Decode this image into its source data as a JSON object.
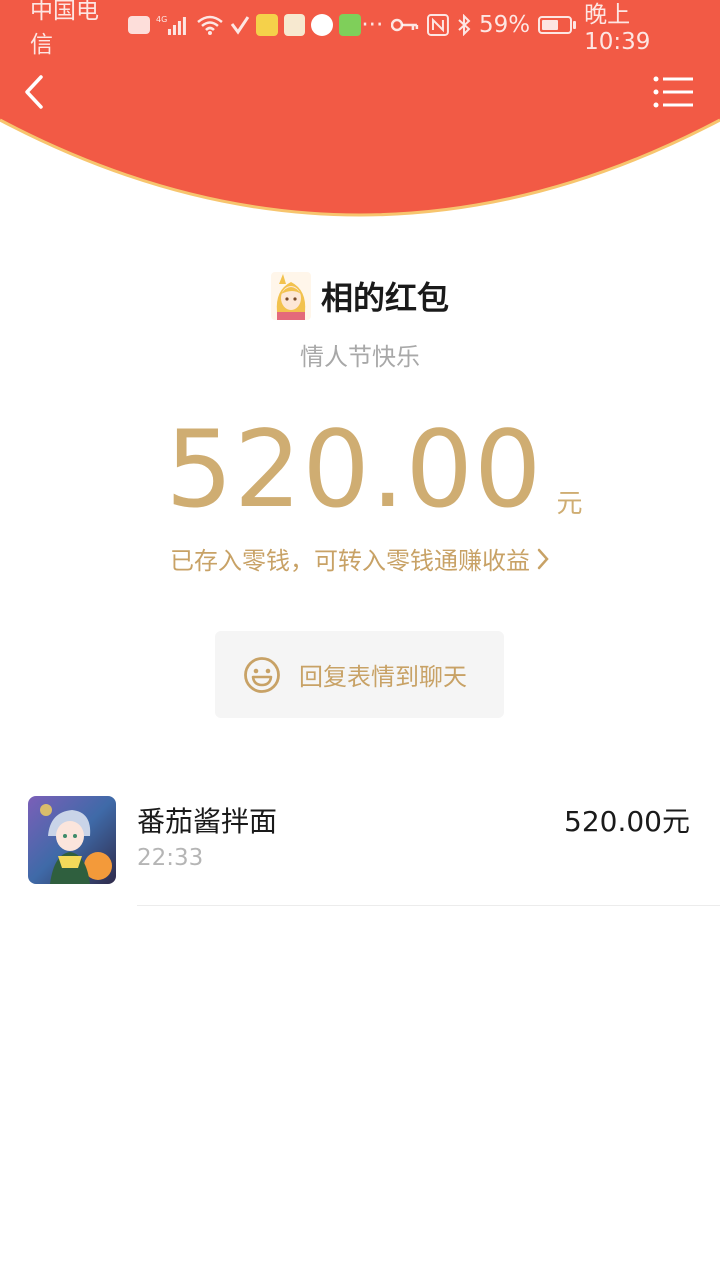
{
  "status_bar": {
    "carrier": "中国电信",
    "battery": "59%",
    "time": "晚上10:39"
  },
  "header": {
    "back_icon": "chevron-left-icon",
    "menu_icon": "list-icon",
    "accent_color": "#f25a45"
  },
  "packet": {
    "sender_name": "相的红包",
    "greeting": "情人节快乐",
    "amount": "520.00",
    "unit": "元",
    "saved_text": "已存入零钱，可转入零钱通赚收益",
    "gold_color": "#cfad72"
  },
  "reply": {
    "icon": "smile-icon",
    "label": "回复表情到聊天"
  },
  "record": {
    "name": "番茄酱拌面",
    "time": "22:33",
    "amount": "520.00元"
  }
}
